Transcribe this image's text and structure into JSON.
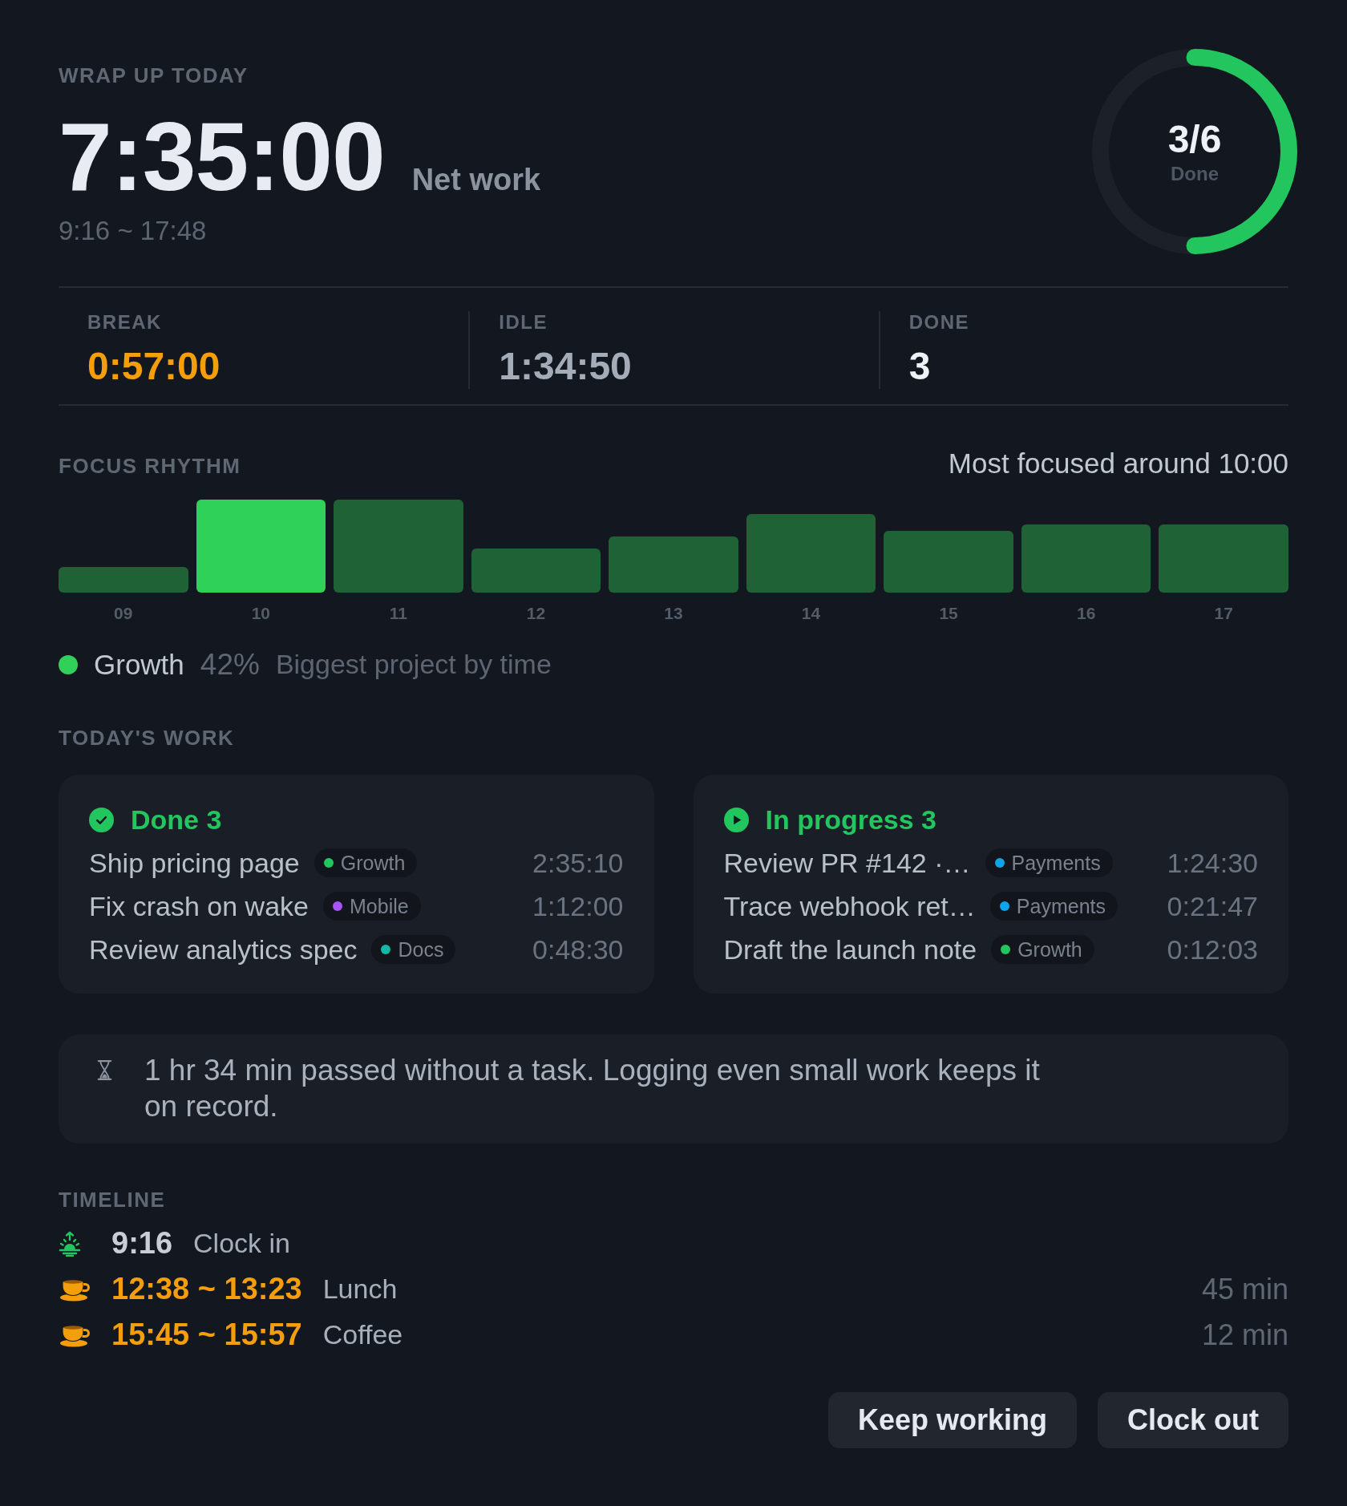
{
  "summary": {
    "eyebrow": "WRAP UP TODAY",
    "net_work": "7:35:00",
    "net_work_label": "Net work",
    "hours_range": "9:16 ~ 17:48",
    "progress": {
      "value": "3/6",
      "label": "Done",
      "level": 0.5
    }
  },
  "stats": [
    {
      "kind": "break",
      "label": "BREAK",
      "value": "0:57:00"
    },
    {
      "kind": "idle",
      "label": "IDLE",
      "value": "1:34:50"
    },
    {
      "kind": "count",
      "label": "DONE",
      "value": "3"
    }
  ],
  "focus_rhythm": {
    "title": "FOCUS RHYTHM",
    "note": "Most focused around 10:00",
    "hours": [
      {
        "label": "09",
        "highlighted": false
      },
      {
        "label": "10",
        "highlighted": true
      },
      {
        "label": "11",
        "highlighted": false
      },
      {
        "label": "12",
        "highlighted": false
      },
      {
        "label": "13",
        "highlighted": false
      },
      {
        "label": "14",
        "highlighted": false
      },
      {
        "label": "15",
        "highlighted": false
      },
      {
        "label": "16",
        "highlighted": false
      },
      {
        "label": "17",
        "highlighted": false
      }
    ],
    "top_project": {
      "name": "Growth",
      "color": "#30d158",
      "share": "42%",
      "caption": "Biggest project by time"
    }
  },
  "todays_work": {
    "title": "TODAY'S WORK",
    "groups": [
      {
        "kind": "done",
        "title": "Done 3",
        "tasks": [
          {
            "title": "Ship pricing page",
            "tag": {
              "name": "Growth",
              "color": "#22c55e"
            },
            "time": "2:35:10"
          },
          {
            "title": "Fix crash on wake",
            "tag": {
              "name": "Mobile",
              "color": "#a855f7"
            },
            "time": "1:12:00"
          },
          {
            "title": "Review analytics spec",
            "tag": {
              "name": "Docs",
              "color": "#14b8a6"
            },
            "time": "0:48:30"
          }
        ]
      },
      {
        "kind": "in_progress",
        "title": "In progress 3",
        "tasks": [
          {
            "title": "Review PR #142 ·…",
            "tag": {
              "name": "Payments",
              "color": "#0ea5e9"
            },
            "time": "1:24:30"
          },
          {
            "title": "Trace webhook ret…",
            "tag": {
              "name": "Payments",
              "color": "#0ea5e9"
            },
            "time": "0:21:47"
          },
          {
            "title": "Draft the launch note",
            "tag": {
              "name": "Growth",
              "color": "#22c55e"
            },
            "time": "0:12:03"
          }
        ]
      }
    ]
  },
  "notice": {
    "text": "1 hr 34 min passed without a task. Logging even small work keeps it on record."
  },
  "timeline": {
    "title": "TIMELINE",
    "events": [
      {
        "kind": "clock_in",
        "time": "9:16",
        "label": "Clock in"
      },
      {
        "kind": "break",
        "time": "12:38 ~ 13:23",
        "label": "Lunch",
        "duration": "45 min"
      },
      {
        "kind": "break",
        "time": "15:45 ~ 15:57",
        "label": "Coffee",
        "duration": "12 min"
      }
    ]
  },
  "buttons": [
    {
      "label": "Keep working"
    },
    {
      "label": "Clock out"
    }
  ]
}
